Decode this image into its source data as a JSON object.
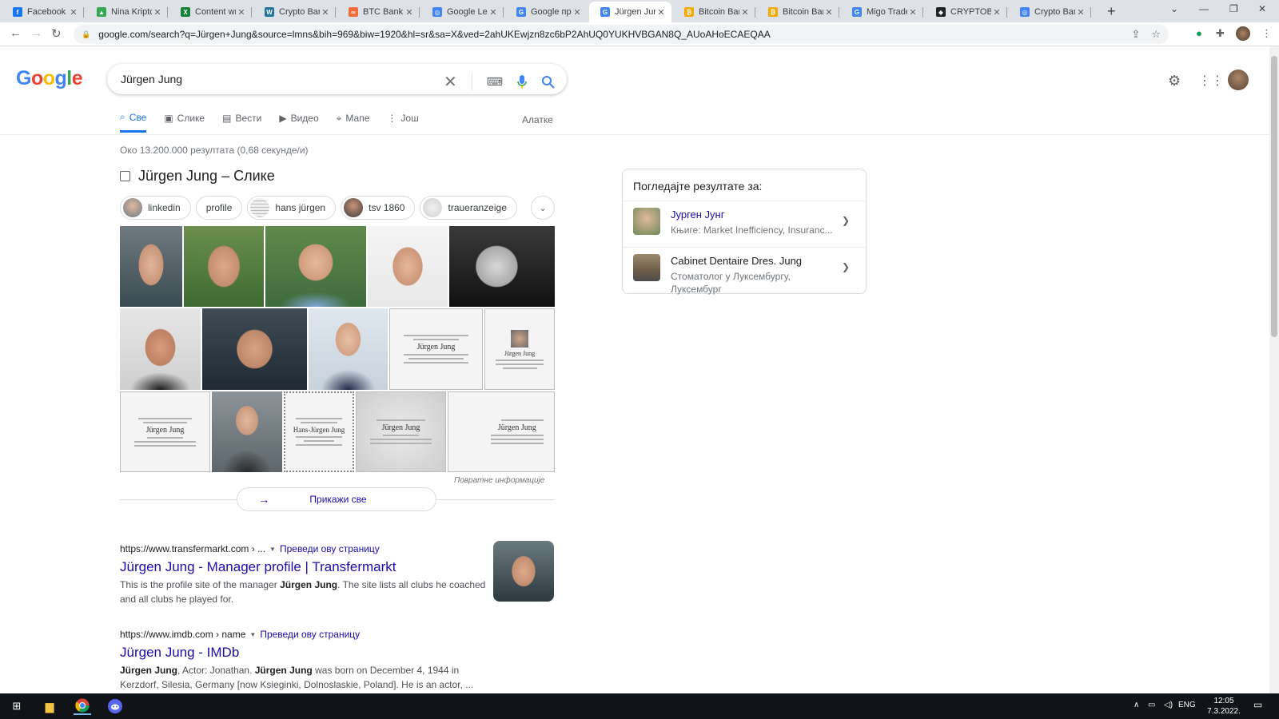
{
  "browser": {
    "tabs": [
      {
        "title": "Facebook",
        "color": "#1877f2",
        "glyph": "f"
      },
      {
        "title": "Nina Kripto",
        "color": "#34a853",
        "glyph": "▲"
      },
      {
        "title": "Content wri",
        "color": "#188038",
        "glyph": "X"
      },
      {
        "title": "Crypto Bank",
        "color": "#21759b",
        "glyph": "W"
      },
      {
        "title": "BTC Bank",
        "color": "#f26b3a",
        "glyph": "∞"
      },
      {
        "title": "Google Len",
        "color": "#4285f4",
        "glyph": "◎"
      },
      {
        "title": "Google пре",
        "color": "#4285f4",
        "glyph": "G"
      },
      {
        "title": "Jürgen Jung",
        "color": "#4285f4",
        "glyph": "G"
      },
      {
        "title": "Bitcoin Ban",
        "color": "#f2a900",
        "glyph": "₿"
      },
      {
        "title": "Bitcoin Ban",
        "color": "#f2a900",
        "glyph": "₿"
      },
      {
        "title": "Migo Trade",
        "color": "#4285f4",
        "glyph": "G"
      },
      {
        "title": "CRYPTOBAN",
        "color": "#202124",
        "glyph": "◆"
      },
      {
        "title": "Crypto Bank",
        "color": "#4285f4",
        "glyph": "◎"
      }
    ],
    "url": "google.com/search?q=Jürgen+Jung&source=lmns&bih=969&biw=1920&hl=sr&sa=X&ved=2ahUKEwjzn8zc6bP2AhUQ0YUKHVBGAN8Q_AUoAHoECAEQAA"
  },
  "google": {
    "logo": "Google",
    "query": "Jürgen Jung",
    "tabs": [
      "Све",
      "Слике",
      "Вести",
      "Видео",
      "Мапе",
      "Још"
    ],
    "tools": "Алатке",
    "stats": "Око 13.200.000 резултата (0,68 секунде/и)"
  },
  "images": {
    "title": "Jürgen Jung – Слике",
    "chips": [
      "linkedin",
      "profile",
      "hans jürgen",
      "tsv 1860",
      "traueranzeige"
    ],
    "notices": [
      "Jürgen Jung",
      "Jürgen Jung",
      "Jürgen Jung",
      "Hans-Jürgen Jung",
      "Jürgen Jung",
      "Jürgen Jung"
    ],
    "feedback": "Повратне информације",
    "show_all": "Прикажи све"
  },
  "results": [
    {
      "cite": "https://www.transfermarkt.com › ...",
      "translate": "Преведи ову страницу",
      "title": "Jürgen Jung - Manager profile | Transfermarkt",
      "s1": "This is the profile site of the manager ",
      "b1": "Jürgen Jung",
      "s2": ". The site lists all clubs he coached and all clubs he played for."
    },
    {
      "cite": "https://www.imdb.com › name",
      "translate": "Преведи ову страницу",
      "title": "Jürgen Jung - IMDb",
      "b1": "Jürgen Jung",
      "s1": ", Actor: Jonathan. ",
      "b2": "Jürgen Jung",
      "s2": " was born on December 4, 1944 in Kerzdorf, Silesia, Germany [now Ksieginki, Dolnoslaskie, Poland]. He is an actor, ..."
    }
  ],
  "panel": {
    "heading": "Погледајте резултате за:",
    "items": [
      {
        "title": "Јурген Јунг",
        "subtitle": "Књиге: Market Inefficiency, Insuranc..."
      },
      {
        "title": "Cabinet Dentaire Dres. Jung",
        "subtitle": "Стоматолог у Луксембургу, Луксембург"
      }
    ]
  },
  "taskbar": {
    "lang": "ENG",
    "time": "12:05",
    "date": "7.3.2022."
  }
}
